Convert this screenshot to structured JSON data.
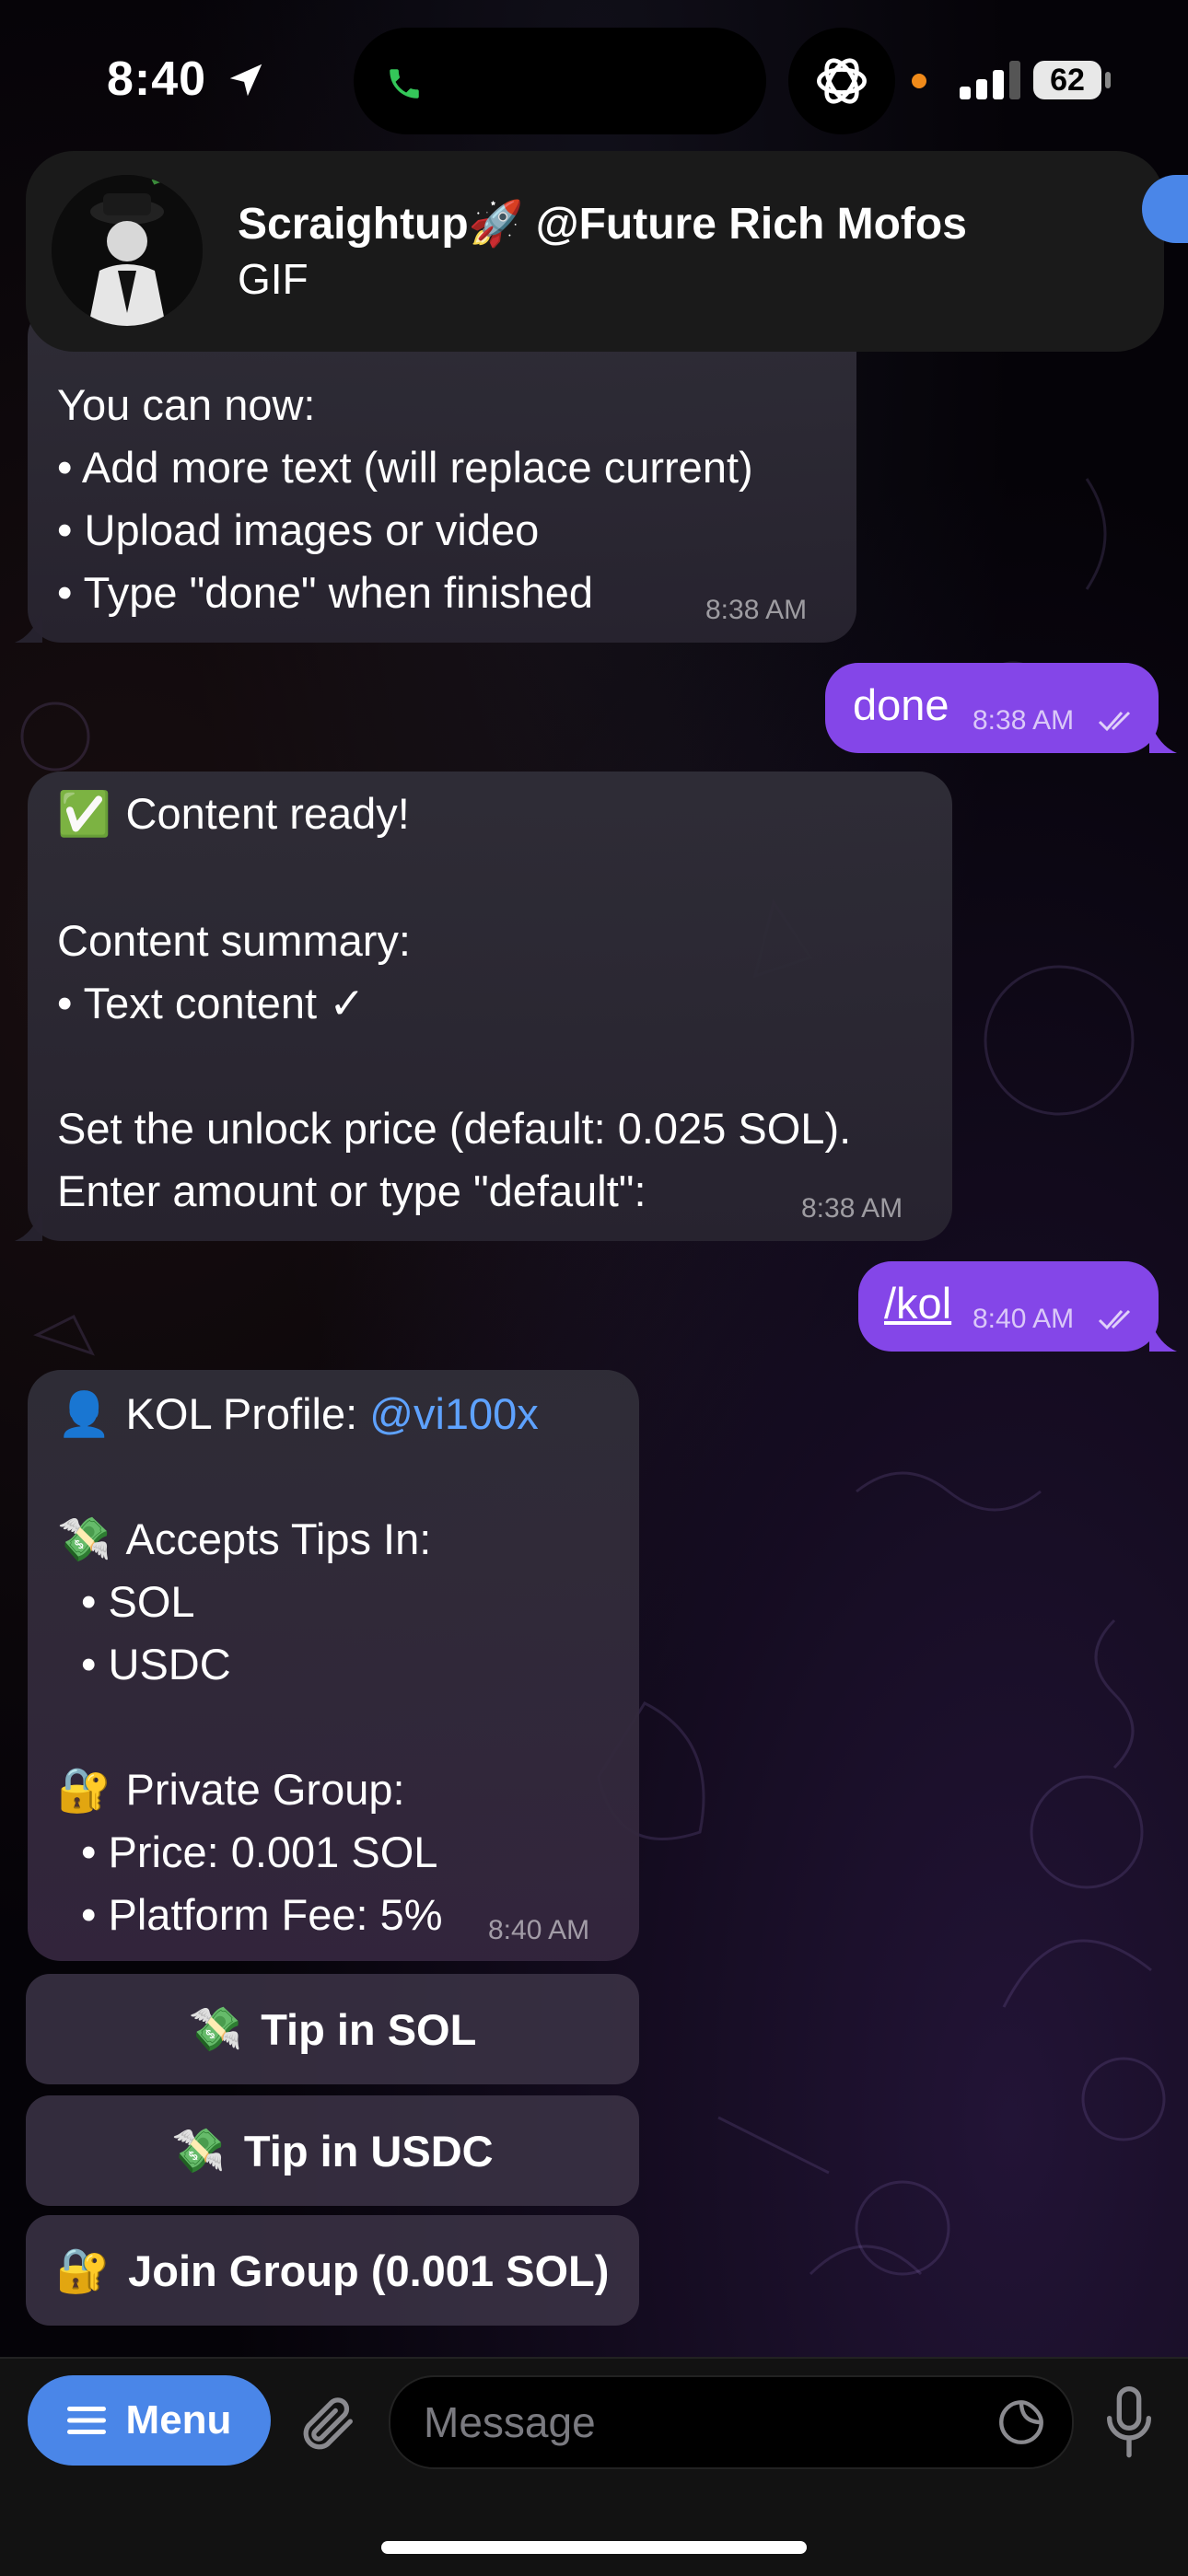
{
  "status_bar": {
    "time": "8:40",
    "battery": "62"
  },
  "notification": {
    "title": "Scraightup🚀 @Future Rich Mofos",
    "subtitle": "GIF"
  },
  "messages": {
    "m1": {
      "lines": [
        "You can now:",
        "• Add more text (will replace current)",
        "• Upload images or video",
        "• Type \"done\" when finished"
      ],
      "time": "8:38 AM"
    },
    "m2": {
      "text": "done",
      "time": "8:38 AM"
    },
    "m3": {
      "line1_emoji": "✅",
      "line1_text": "Content ready!",
      "line2": "Content summary:",
      "line3": "• Text content ✓",
      "line4": "Set the unlock price (default: 0.025 SOL).",
      "line5": "Enter amount or type \"default\":",
      "time": "8:38 AM"
    },
    "m4": {
      "text": "/kol",
      "time": "8:40 AM"
    },
    "m5": {
      "profile_emoji": "👤",
      "profile_label": "KOL Profile: ",
      "profile_handle": "@vi100x",
      "tips_emoji": "💸",
      "tips_label": "Accepts Tips In:",
      "tip1": "• SOL",
      "tip2": "• USDC",
      "group_emoji": "🔐",
      "group_label": "Private Group:",
      "price": "• Price: 0.001 SOL",
      "fee": "• Platform Fee: 5%",
      "time": "8:40 AM"
    }
  },
  "inline_buttons": [
    {
      "emoji": "💸",
      "label": "Tip in SOL"
    },
    {
      "emoji": "💸",
      "label": "Tip in USDC"
    },
    {
      "emoji": "🔐",
      "label": "Join Group (0.001 SOL)"
    }
  ],
  "composer": {
    "menu_label": "Menu",
    "placeholder": "Message"
  },
  "colors": {
    "accent": "#4a86e8",
    "outgoing": "#8446e8",
    "link": "#5ea2ff"
  },
  "icons": [
    "location-arrow-icon",
    "phone-icon",
    "chatgpt-icon",
    "signal-icon",
    "battery-icon",
    "hamburger-icon",
    "paperclip-icon",
    "sticker-icon",
    "microphone-icon",
    "double-check-icon"
  ]
}
